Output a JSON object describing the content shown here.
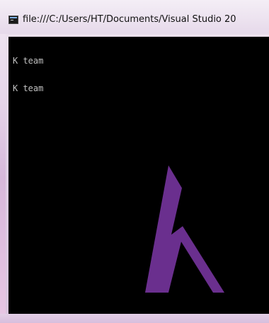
{
  "window": {
    "title": "file:///C:/Users/HT/Documents/Visual Studio 20"
  },
  "console": {
    "lines": [
      "K team",
      "K team"
    ]
  },
  "colors": {
    "logo": "#6a2f8e",
    "console_bg": "#000000",
    "console_text": "#c0c0c0"
  },
  "icons": {
    "app": "console-app-icon"
  }
}
